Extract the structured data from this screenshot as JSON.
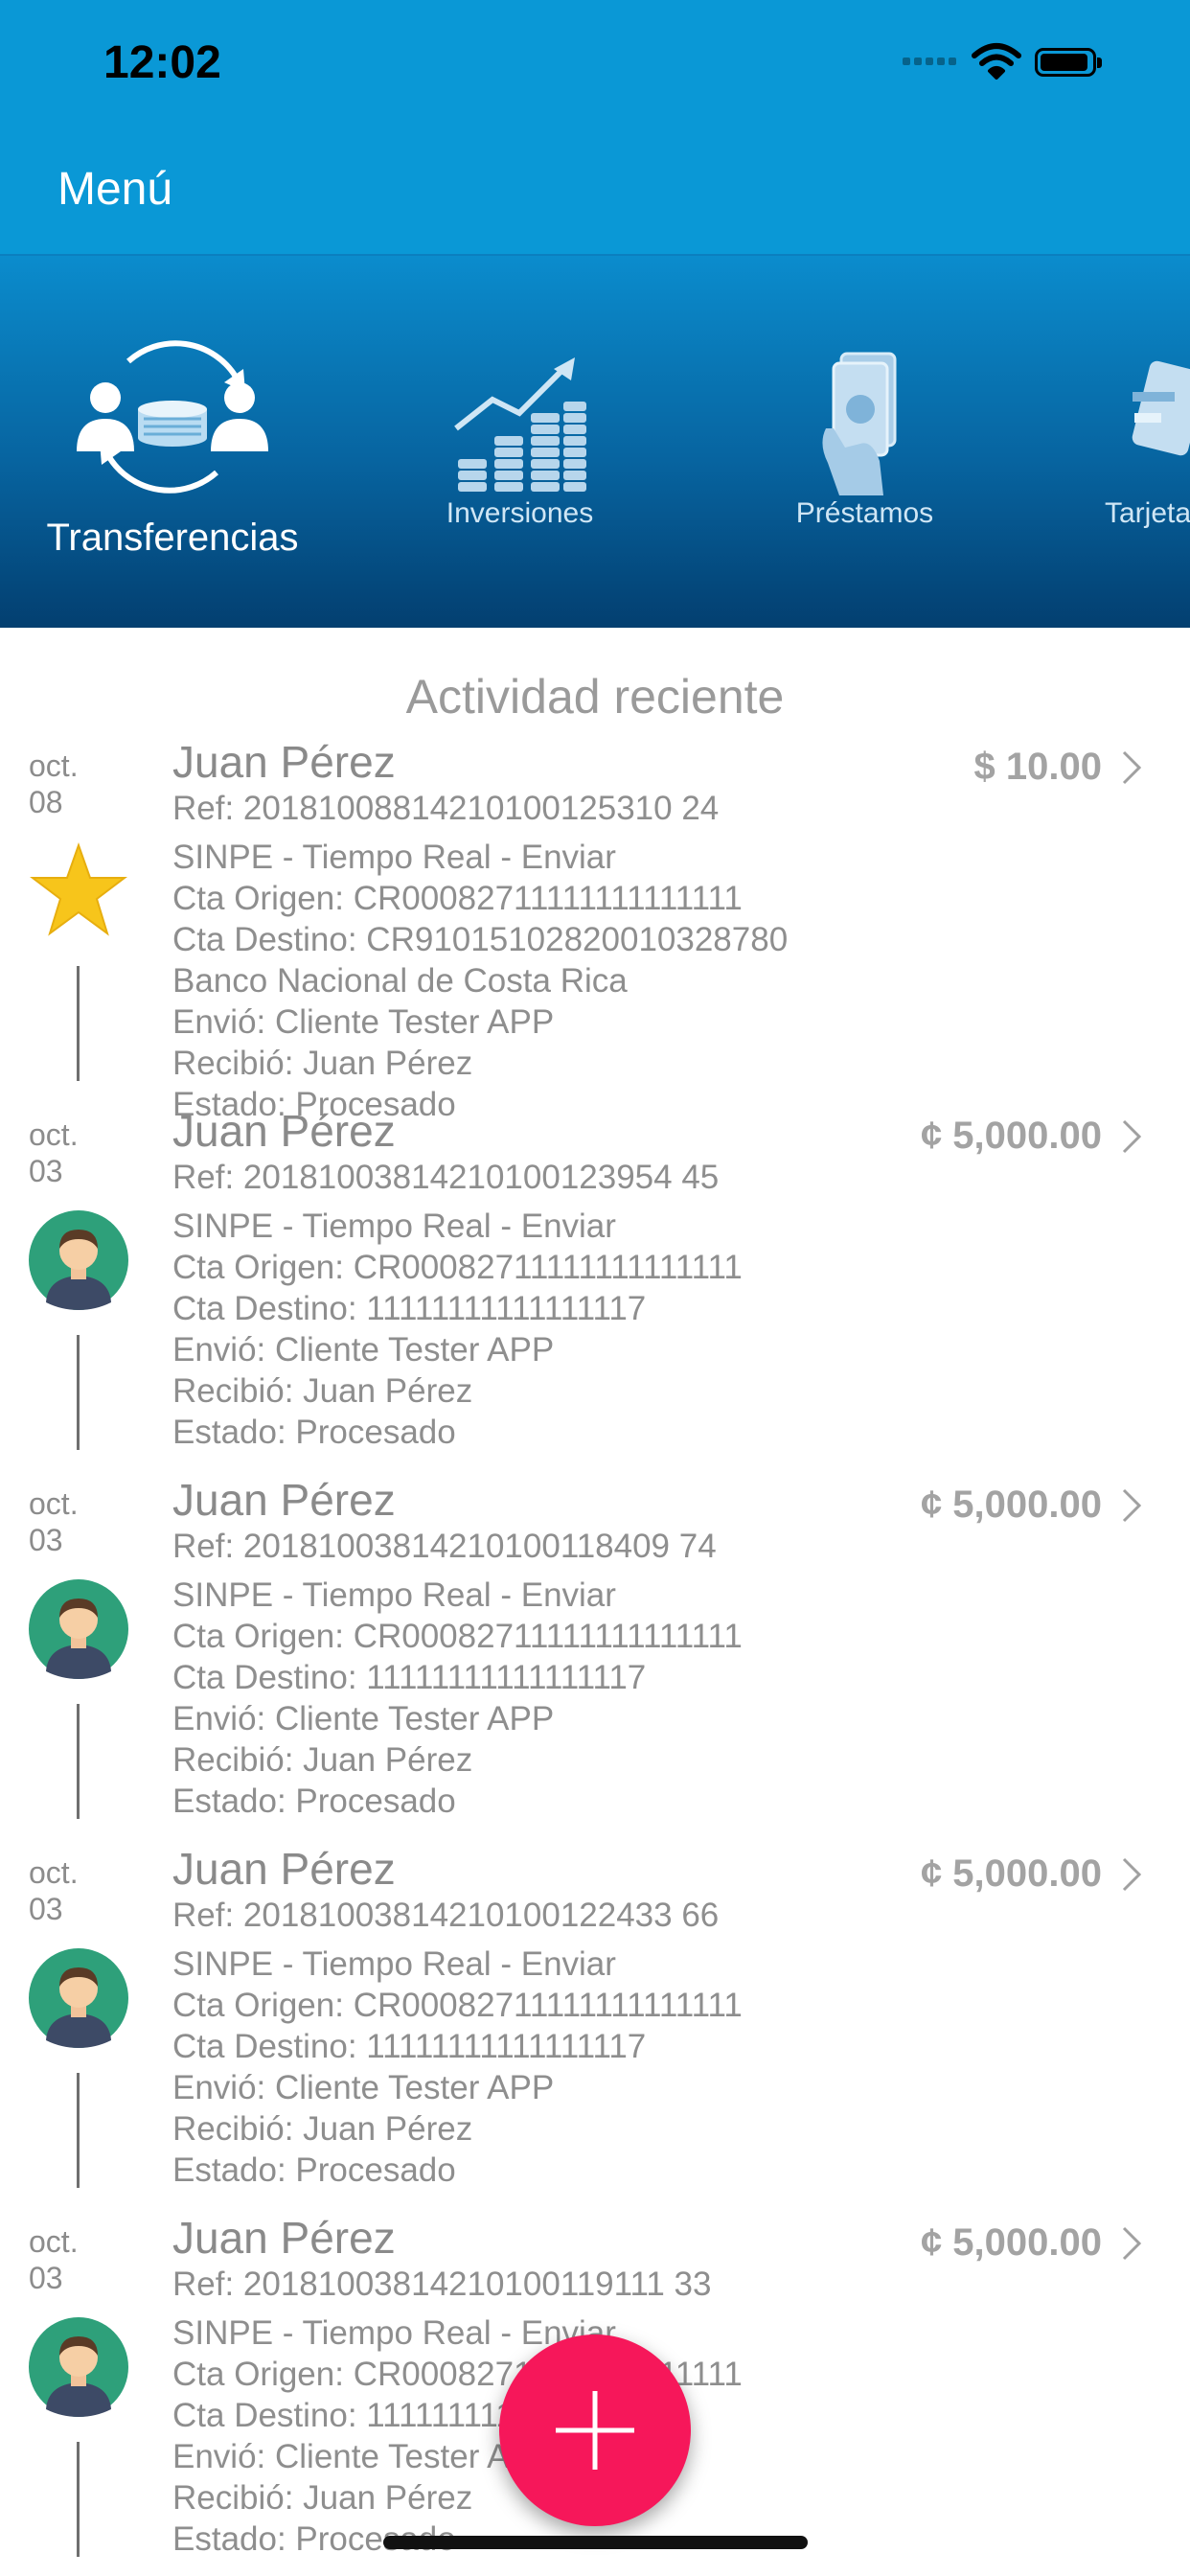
{
  "status_bar": {
    "time": "12:02"
  },
  "nav": {
    "menu_label": "Menú"
  },
  "categories": [
    {
      "label": "Transferencias",
      "icon": "transfer-icon",
      "active": true
    },
    {
      "label": "Inversiones",
      "icon": "investment-chart-icon",
      "active": false
    },
    {
      "label": "Préstamos",
      "icon": "loan-hand-icon",
      "active": false
    },
    {
      "label": "Tarjetas",
      "icon": "card-icon",
      "active": false
    }
  ],
  "section_title": "Actividad reciente",
  "transactions": [
    {
      "month": "oct.",
      "day": "08",
      "avatar": "star-icon",
      "name": "Juan Pérez",
      "amount": "$ 10.00",
      "ref": "Ref:  20181008814210100125310 24",
      "lines": [
        "SINPE -  Tiempo Real -  Enviar",
        "Cta Origen:  CR00082711111111111111",
        "Cta Destino:  CR91015102820010328780",
        "Banco Nacional de Costa Rica",
        "Envió:  Cliente Tester APP",
        "Recibió:  Juan Pérez",
        "Estado:  Procesado"
      ]
    },
    {
      "month": "oct.",
      "day": "03",
      "avatar": "user-avatar-icon",
      "name": "Juan Pérez",
      "amount": "¢ 5,000.00",
      "ref": "Ref:  20181003814210100123954 45",
      "lines": [
        "SINPE -  Tiempo Real -  Enviar",
        "Cta Origen:  CR00082711111111111111",
        "Cta Destino:  11111111111111117",
        "Envió:  Cliente Tester APP",
        "Recibió:  Juan Pérez",
        "Estado:  Procesado"
      ]
    },
    {
      "month": "oct.",
      "day": "03",
      "avatar": "user-avatar-icon",
      "name": "Juan Pérez",
      "amount": "¢ 5,000.00",
      "ref": "Ref:  20181003814210100118409 74",
      "lines": [
        "SINPE -  Tiempo Real -  Enviar",
        "Cta Origen:  CR00082711111111111111",
        "Cta Destino:  11111111111111117",
        "Envió:  Cliente Tester APP",
        "Recibió:  Juan Pérez",
        "Estado:  Procesado"
      ]
    },
    {
      "month": "oct.",
      "day": "03",
      "avatar": "user-avatar-icon",
      "name": "Juan Pérez",
      "amount": "¢ 5,000.00",
      "ref": "Ref:  20181003814210100122433 66",
      "lines": [
        "SINPE -  Tiempo Real -  Enviar",
        "Cta Origen:  CR00082711111111111111",
        "Cta Destino:  11111111111111117",
        "Envió:  Cliente Tester APP",
        "Recibió:  Juan Pérez",
        "Estado:  Procesado"
      ]
    },
    {
      "month": "oct.",
      "day": "03",
      "avatar": "user-avatar-icon",
      "name": "Juan Pérez",
      "amount": "¢ 5,000.00",
      "ref": "Ref:  20181003814210100119111 33",
      "lines": [
        "SINPE -  Tiempo Real -  Enviar",
        "Cta Origen:  CR00082711111111111111",
        "Cta Destino:  11111111111111117",
        "Envió:  Cliente Tester APP",
        "Recibió:  Juan Pérez",
        "Estado:  Procesado"
      ]
    }
  ],
  "fab": {
    "icon": "plus-icon"
  },
  "colors": {
    "header": "#0a98d6",
    "carousel_top": "#0b8ccd",
    "carousel_bottom": "#033f70",
    "fab": "#f6175a",
    "avatar_bg": "#2ea07a",
    "star": "#f7c51b"
  }
}
